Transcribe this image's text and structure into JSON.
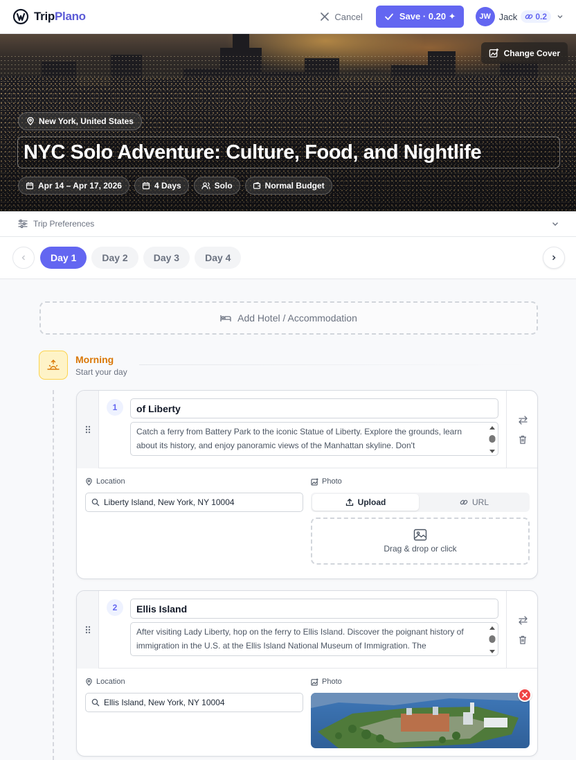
{
  "app": {
    "logo_part1": "Trip",
    "logo_part2": "Plano"
  },
  "header": {
    "cancel_label": "Cancel",
    "save_label": "Save · 0.20 ✦",
    "avatar_initials": "JW",
    "user_name": "Jack",
    "credits": "0.2"
  },
  "hero": {
    "change_cover_label": "Change Cover",
    "location": "New York, United States",
    "title": "NYC Solo Adventure: Culture, Food, and Nightlife",
    "dates": "Apr 14 – Apr 17, 2026",
    "days": "4 Days",
    "travel_type": "Solo",
    "budget": "Normal Budget"
  },
  "preferences": {
    "label": "Trip Preferences"
  },
  "day_tabs": [
    {
      "label": "Day 1",
      "active": true
    },
    {
      "label": "Day 2",
      "active": false
    },
    {
      "label": "Day 3",
      "active": false
    },
    {
      "label": "Day 4",
      "active": false
    }
  ],
  "hotel": {
    "label": "Add Hotel / Accommodation"
  },
  "morning": {
    "title": "Morning",
    "subtitle": "Start your day"
  },
  "labels": {
    "location": "Location",
    "photo": "Photo",
    "upload": "Upload",
    "url": "URL",
    "drag_drop": "Drag & drop or click"
  },
  "activities": [
    {
      "number": "1",
      "name": "of Liberty",
      "description": "Catch a ferry from Battery Park to the iconic Statue of Liberty. Explore the grounds, learn about its history, and enjoy panoramic views of the Manhattan skyline. Don't",
      "location": "Liberty Island, New York, NY 10004"
    },
    {
      "number": "2",
      "name": "Ellis Island",
      "description": "After visiting Lady Liberty, hop on the ferry to Ellis Island. Discover the poignant history of immigration in the U.S. at the Ellis Island National Museum of Immigration. The",
      "location": "Ellis Island, New York, NY 10004"
    }
  ],
  "colors": {
    "accent": "#6366f1",
    "morning": "#d97706",
    "danger": "#ef4444"
  }
}
